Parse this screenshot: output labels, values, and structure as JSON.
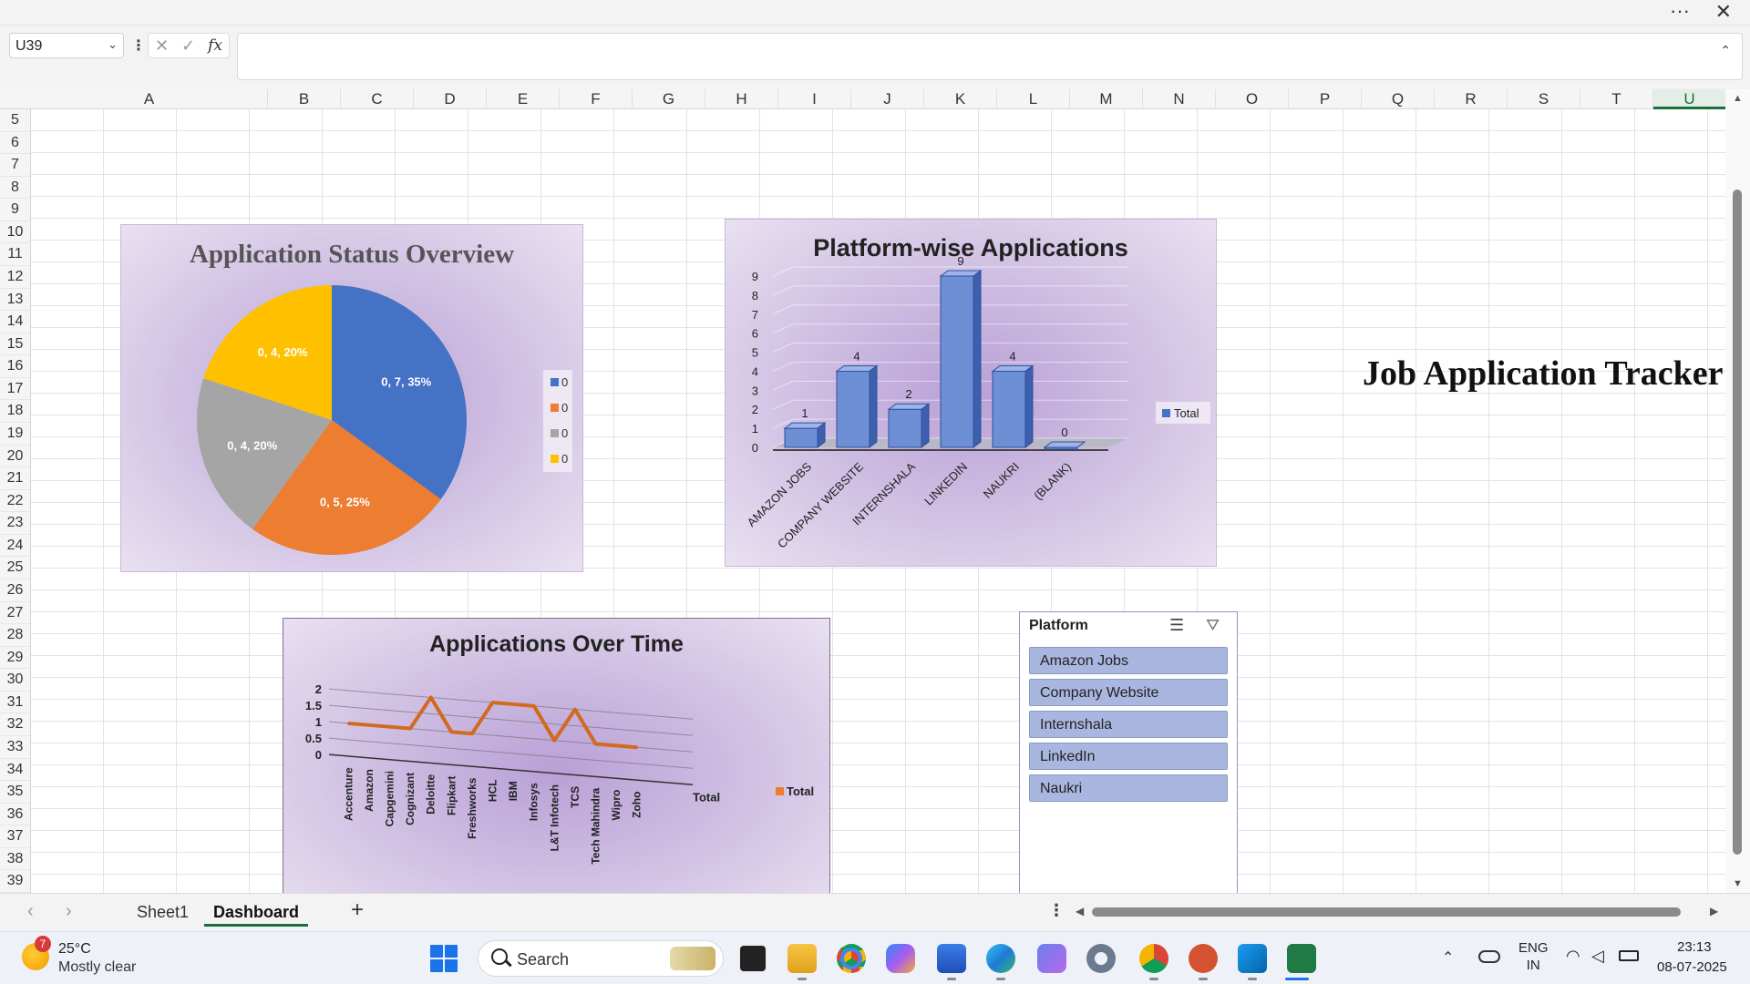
{
  "formula_bar": {
    "name_box": "U39",
    "fx_label": "fx",
    "formula": ""
  },
  "columns": [
    "A",
    "B",
    "C",
    "D",
    "E",
    "F",
    "G",
    "H",
    "I",
    "J",
    "K",
    "L",
    "M",
    "N",
    "O",
    "P",
    "Q",
    "R",
    "S",
    "T",
    "U"
  ],
  "active_column": "U",
  "rows": [
    "5",
    "6",
    "7",
    "8",
    "9",
    "10",
    "11",
    "12",
    "13",
    "14",
    "15",
    "16",
    "17",
    "18",
    "19",
    "20",
    "21",
    "22",
    "23",
    "24",
    "25",
    "26",
    "27",
    "28",
    "29",
    "30",
    "31",
    "32",
    "33",
    "34",
    "35",
    "36",
    "37",
    "38",
    "39"
  ],
  "sheet_title": "Job Application Tracker",
  "chart_data": [
    {
      "type": "pie",
      "title": "Application Status Overview",
      "slices": [
        {
          "label": "0, 7, 35%",
          "value": 7,
          "percent": 35,
          "color": "#4472c4"
        },
        {
          "label": "0, 5, 25%",
          "value": 5,
          "percent": 25,
          "color": "#ed7d31"
        },
        {
          "label": "0, 4, 20%",
          "value": 4,
          "percent": 20,
          "color": "#a5a5a5"
        },
        {
          "label": "0, 4, 20%",
          "value": 4,
          "percent": 20,
          "color": "#ffc000"
        }
      ],
      "legend": {
        "position": "right",
        "entries": [
          "0",
          "0",
          "0",
          "0"
        ]
      }
    },
    {
      "type": "bar",
      "title": "Platform-wise Applications",
      "categories": [
        "AMAZON JOBS",
        "COMPANY WEBSITE",
        "INTERNSHALA",
        "LINKEDIN",
        "NAUKRI",
        "(BLANK)"
      ],
      "series": [
        {
          "name": "Total",
          "values": [
            1,
            4,
            2,
            9,
            4,
            0
          ],
          "color": "#4472c4"
        }
      ],
      "yticks": [
        "0",
        "1",
        "2",
        "3",
        "4",
        "5",
        "6",
        "7",
        "8",
        "9"
      ],
      "ylim": [
        0,
        9
      ],
      "legend": {
        "position": "right"
      }
    },
    {
      "type": "line",
      "title": "Applications Over Time",
      "categories": [
        "Accenture",
        "Amazon",
        "Capgemini",
        "Cognizant",
        "Deloitte",
        "Flipkart",
        "Freshworks",
        "HCL",
        "IBM",
        "Infosys",
        "L&T Infotech",
        "TCS",
        "Tech Mahindra",
        "Wipro",
        "Zoho"
      ],
      "series": [
        {
          "name": "Total",
          "values": [
            1,
            1,
            1,
            1,
            2,
            1,
            1,
            2,
            2,
            2,
            1,
            2,
            1,
            1,
            1
          ],
          "color": "#ed7d31"
        }
      ],
      "yticks": [
        "0",
        "0.5",
        "1",
        "1.5",
        "2"
      ],
      "ylim": [
        0,
        2
      ],
      "depth_axis_label": "Total",
      "legend": {
        "position": "right"
      }
    }
  ],
  "slicer": {
    "title": "Platform",
    "items": [
      "Amazon Jobs",
      "Company Website",
      "Internshala",
      "LinkedIn",
      "Naukri"
    ]
  },
  "tabs": {
    "sheets": [
      "Sheet1",
      "Dashboard"
    ],
    "active": "Dashboard",
    "add_label": "+"
  },
  "taskbar": {
    "weather_temp": "25°C",
    "weather_desc": "Mostly clear",
    "weather_badge": "7",
    "search_label": "Search",
    "lang_line1": "ENG",
    "lang_line2": "IN",
    "time": "23:13",
    "date": "08-07-2025"
  }
}
